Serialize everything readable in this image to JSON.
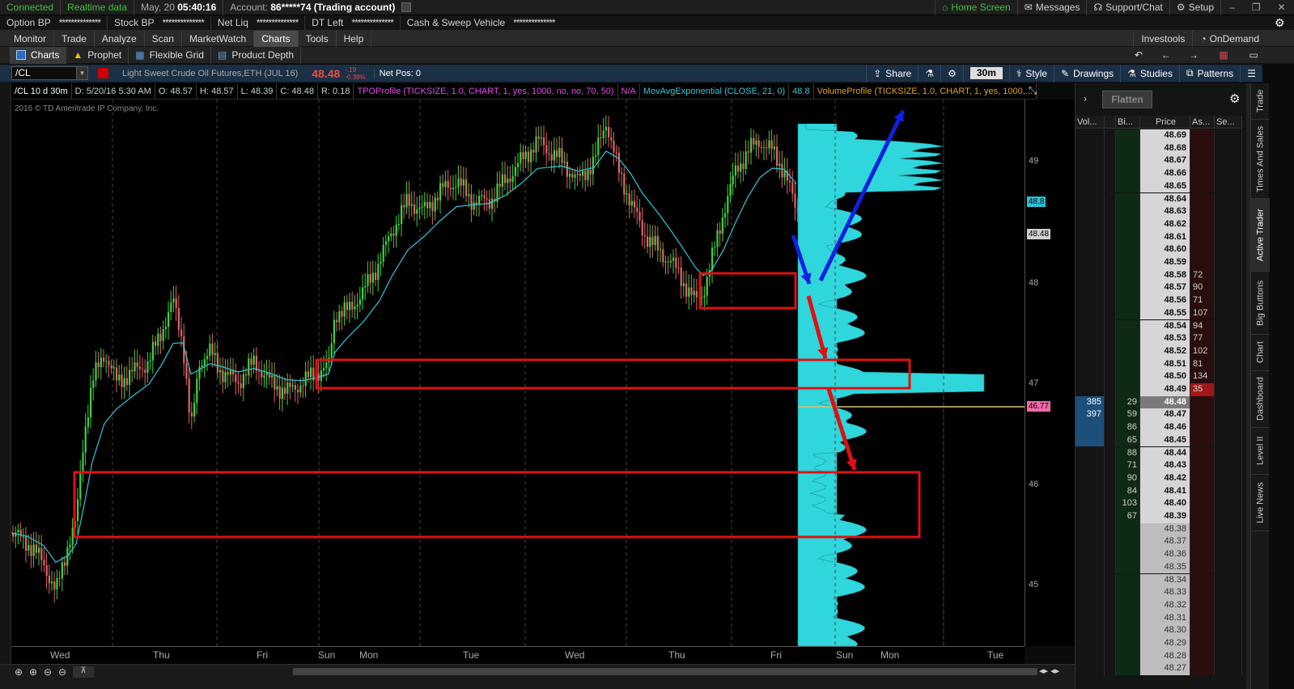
{
  "status": {
    "connection": "Connected",
    "data_feed": "Realtime data",
    "date": "May, 20",
    "time": "05:40:16",
    "account_label": "Account:",
    "account_value": "86*****74 (Trading account)",
    "home_screen": "Home Screen",
    "messages": "Messages",
    "support": "Support/Chat",
    "setup": "Setup"
  },
  "balances": [
    {
      "label": "Option BP",
      "value": "**************"
    },
    {
      "label": "Stock BP",
      "value": "**************"
    },
    {
      "label": "Net Liq",
      "value": "**************"
    },
    {
      "label": "DT Left",
      "value": "**************"
    },
    {
      "label": "Cash & Sweep Vehicle",
      "value": "**************"
    }
  ],
  "menu": {
    "tabs": [
      "Monitor",
      "Trade",
      "Analyze",
      "Scan",
      "MarketWatch",
      "Charts",
      "Tools",
      "Help"
    ],
    "active": "Charts",
    "investools": "Investools",
    "ondemand": "OnDemand"
  },
  "subtabs": {
    "items": [
      "Charts",
      "Prophet",
      "Flexible Grid",
      "Product Depth"
    ],
    "active": "Charts"
  },
  "chartbar": {
    "symbol": "/CL",
    "description": "Light Sweet Crude Oil Futures,ETH (JUL 16)",
    "last": "48.48",
    "change": "-.19",
    "change_pct": "-0.39%",
    "net_pos": "Net Pos: 0",
    "share": "Share",
    "timeframe": "30m",
    "style": "Style",
    "drawings": "Drawings",
    "studies": "Studies",
    "patterns": "Patterns"
  },
  "studybar": {
    "period": "/CL 10 d 30m",
    "date": "D: 5/20/16 5:30 AM",
    "open": "O: 48.57",
    "high": "H: 48.57",
    "low": "L: 48.39",
    "close": "C: 48.48",
    "range": "R: 0.18",
    "tpo": "TPOProfile (TICKSIZE, 1.0, CHART, 1, yes, 1000, no, no, 70, 50)",
    "tpo_val": "N/A",
    "ema": "MovAvgExponential (CLOSE, 21, 0)",
    "ema_val": "48.8",
    "volprofile": "VolumeProfile (TICKSIZE, 1.0, CHART, 1, yes, 1000,..."
  },
  "copyright": "2016 © TD Ameritrade IP Company, Inc.",
  "y_ticks": [
    "49",
    "48",
    "47",
    "46",
    "45"
  ],
  "y_badges": [
    {
      "text": "48.8",
      "color": "#27c2d6"
    },
    {
      "text": "48.48",
      "color": "#cfcfcf"
    },
    {
      "text": "46.77",
      "color": "#f06aa8"
    }
  ],
  "x_labels": [
    "Wed",
    "Thu",
    "Fri",
    "Sun",
    "Mon",
    "Tue",
    "Wed",
    "Thu",
    "Fri",
    "Sun",
    "Mon",
    "Tue"
  ],
  "colors": {
    "up": "#3fd23f",
    "down": "#e0656a",
    "ema": "#33c6d6",
    "profile": "#2fd6dc",
    "profile_dark": "#1a8f94",
    "box": "#e01010",
    "arrow_blue": "#1020e0",
    "arrow_red": "#e01010"
  },
  "active_trader": {
    "flatten": "Flatten",
    "headers": [
      "Vol...",
      "",
      "Bi...",
      "Price",
      "As...",
      "Se..."
    ],
    "rows": [
      {
        "vol": "",
        "bid": "",
        "price": "48.69",
        "ask": ""
      },
      {
        "vol": "",
        "bid": "",
        "price": "48.68",
        "ask": ""
      },
      {
        "vol": "",
        "bid": "",
        "price": "48.67",
        "ask": ""
      },
      {
        "vol": "",
        "bid": "",
        "price": "48.66",
        "ask": ""
      },
      {
        "vol": "",
        "bid": "",
        "price": "48.65",
        "ask": ""
      },
      {
        "vol": "",
        "bid": "",
        "price": "48.64",
        "ask": ""
      },
      {
        "vol": "",
        "bid": "",
        "price": "48.63",
        "ask": ""
      },
      {
        "vol": "",
        "bid": "",
        "price": "48.62",
        "ask": ""
      },
      {
        "vol": "",
        "bid": "",
        "price": "48.61",
        "ask": ""
      },
      {
        "vol": "",
        "bid": "",
        "price": "48.60",
        "ask": ""
      },
      {
        "vol": "",
        "bid": "",
        "price": "48.59",
        "ask": ""
      },
      {
        "vol": "",
        "bid": "",
        "price": "48.58",
        "ask": "72"
      },
      {
        "vol": "",
        "bid": "",
        "price": "48.57",
        "ask": "90"
      },
      {
        "vol": "",
        "bid": "",
        "price": "48.56",
        "ask": "71"
      },
      {
        "vol": "",
        "bid": "",
        "price": "48.55",
        "ask": "107"
      },
      {
        "vol": "",
        "bid": "",
        "price": "48.54",
        "ask": "94"
      },
      {
        "vol": "",
        "bid": "",
        "price": "48.53",
        "ask": "77"
      },
      {
        "vol": "",
        "bid": "",
        "price": "48.52",
        "ask": "102"
      },
      {
        "vol": "",
        "bid": "",
        "price": "48.51",
        "ask": "81"
      },
      {
        "vol": "",
        "bid": "",
        "price": "48.50",
        "ask": "134"
      },
      {
        "vol": "",
        "bid": "",
        "price": "48.49",
        "ask": "35"
      },
      {
        "vol": "385",
        "bid": "29",
        "price": "48.48",
        "ask": ""
      },
      {
        "vol": "397",
        "bid": "59",
        "price": "48.47",
        "ask": ""
      },
      {
        "vol": "",
        "bid": "86",
        "price": "48.46",
        "ask": ""
      },
      {
        "vol": "",
        "bid": "65",
        "price": "48.45",
        "ask": ""
      },
      {
        "vol": "",
        "bid": "88",
        "price": "48.44",
        "ask": ""
      },
      {
        "vol": "",
        "bid": "71",
        "price": "48.43",
        "ask": ""
      },
      {
        "vol": "",
        "bid": "90",
        "price": "48.42",
        "ask": ""
      },
      {
        "vol": "",
        "bid": "84",
        "price": "48.41",
        "ask": ""
      },
      {
        "vol": "",
        "bid": "103",
        "price": "48.40",
        "ask": ""
      },
      {
        "vol": "",
        "bid": "67",
        "price": "48.39",
        "ask": ""
      },
      {
        "vol": "",
        "bid": "",
        "price": "48.38",
        "ask": ""
      },
      {
        "vol": "",
        "bid": "",
        "price": "48.37",
        "ask": ""
      },
      {
        "vol": "",
        "bid": "",
        "price": "48.36",
        "ask": ""
      },
      {
        "vol": "",
        "bid": "",
        "price": "48.35",
        "ask": ""
      },
      {
        "vol": "",
        "bid": "",
        "price": "48.34",
        "ask": ""
      },
      {
        "vol": "",
        "bid": "",
        "price": "48.33",
        "ask": ""
      },
      {
        "vol": "",
        "bid": "",
        "price": "48.32",
        "ask": ""
      },
      {
        "vol": "",
        "bid": "",
        "price": "48.31",
        "ask": ""
      },
      {
        "vol": "",
        "bid": "",
        "price": "48.30",
        "ask": ""
      },
      {
        "vol": "",
        "bid": "",
        "price": "48.29",
        "ask": ""
      },
      {
        "vol": "",
        "bid": "",
        "price": "48.28",
        "ask": ""
      },
      {
        "vol": "",
        "bid": "",
        "price": "48.27",
        "ask": ""
      }
    ]
  },
  "side_tabs": [
    "Trade",
    "Times And Sales",
    "Active Trader",
    "Big Buttons",
    "Chart",
    "Dashboard",
    "Level II",
    "Live News"
  ]
}
